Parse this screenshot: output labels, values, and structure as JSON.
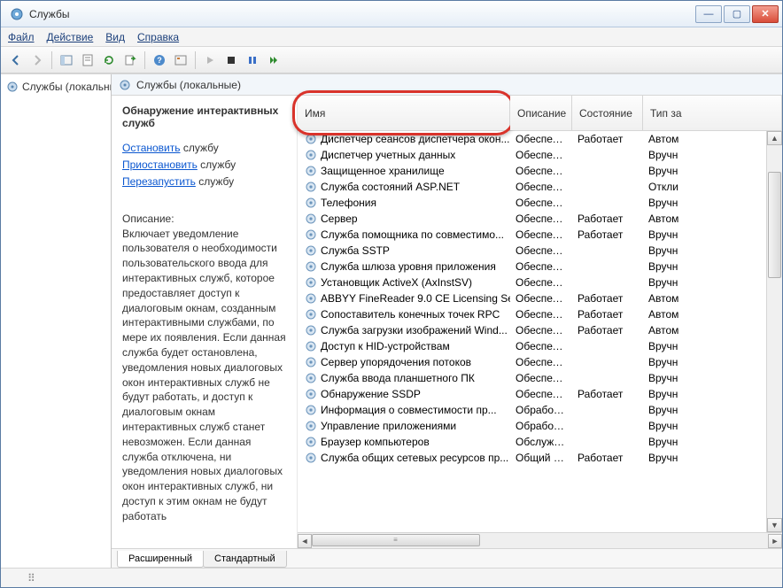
{
  "window": {
    "title": "Службы"
  },
  "menu": {
    "file": "Файл",
    "action": "Действие",
    "view": "Вид",
    "help": "Справка"
  },
  "toolbar_icons": [
    "back",
    "forward",
    "sep",
    "show-hide",
    "props",
    "export",
    "refresh",
    "export-list",
    "sep",
    "help",
    "filter",
    "sep",
    "play",
    "stop",
    "pause",
    "restart"
  ],
  "tree": {
    "root": "Службы (локальны"
  },
  "main_header": "Службы (локальные)",
  "detail": {
    "service_name": "Обнаружение интерактивных служб",
    "actions": {
      "stop_link": "Остановить",
      "stop_suffix": " службу",
      "pause_link": "Приостановить",
      "pause_suffix": " службу",
      "restart_link": "Перезапустить",
      "restart_suffix": " службу"
    },
    "desc_label": "Описание:",
    "desc_text": "Включает уведомление пользователя о необходимости пользовательского ввода для интерактивных служб, которое предоставляет доступ к диалоговым окнам, созданным интерактивными службами, по мере их появления. Если данная служба будет остановлена, уведомления новых диалоговых окон интерактивных служб не будут работать, и доступ к диалоговым окнам интерактивных служб станет невозможен. Если данная служба отключена, ни уведомления новых диалоговых окон интерактивных служб, ни доступ к этим окнам не будут работать"
  },
  "columns": {
    "name": "Имя",
    "desc": "Описание",
    "state": "Состояние",
    "type": "Тип за"
  },
  "services": [
    {
      "name": "Диспетчер сеансов диспетчера окон...",
      "desc": "Обеспечи...",
      "state": "Работает",
      "type": "Автом"
    },
    {
      "name": "Диспетчер учетных данных",
      "desc": "Обеспечи...",
      "state": "",
      "type": "Вручн"
    },
    {
      "name": "Защищенное хранилище",
      "desc": "Обеспечи...",
      "state": "",
      "type": "Вручн"
    },
    {
      "name": "Служба состояний ASP.NET",
      "desc": "Обеспечи...",
      "state": "",
      "type": "Откли"
    },
    {
      "name": "Телефония",
      "desc": "Обеспечи...",
      "state": "",
      "type": "Вручн"
    },
    {
      "name": "Сервер",
      "desc": "Обеспечи...",
      "state": "Работает",
      "type": "Автом"
    },
    {
      "name": "Служба помощника по совместимо...",
      "desc": "Обеспечи...",
      "state": "Работает",
      "type": "Вручн"
    },
    {
      "name": "Служба SSTP",
      "desc": "Обеспечи...",
      "state": "",
      "type": "Вручн"
    },
    {
      "name": "Служба шлюза уровня приложения",
      "desc": "Обеспечи...",
      "state": "",
      "type": "Вручн"
    },
    {
      "name": "Установщик ActiveX (AxInstSV)",
      "desc": "Обеспечи...",
      "state": "",
      "type": "Вручн"
    },
    {
      "name": "ABBYY FineReader 9.0 CE Licensing Se...",
      "desc": "Обеспечи...",
      "state": "Работает",
      "type": "Автом"
    },
    {
      "name": "Сопоставитель конечных точек RPC",
      "desc": "Обеспечи...",
      "state": "Работает",
      "type": "Автом"
    },
    {
      "name": "Служба загрузки изображений Wind...",
      "desc": "Обеспечи...",
      "state": "Работает",
      "type": "Автом"
    },
    {
      "name": "Доступ к HID-устройствам",
      "desc": "Обеспечи...",
      "state": "",
      "type": "Вручн"
    },
    {
      "name": "Сервер упорядочения потоков",
      "desc": "Обеспечи...",
      "state": "",
      "type": "Вручн"
    },
    {
      "name": "Служба ввода планшетного ПК",
      "desc": "Обеспечи...",
      "state": "",
      "type": "Вручн"
    },
    {
      "name": "Обнаружение SSDP",
      "desc": "Обеспечи...",
      "state": "Работает",
      "type": "Вручн"
    },
    {
      "name": "Информация о совместимости пр...",
      "desc": "Обработк...",
      "state": "",
      "type": "Вручн"
    },
    {
      "name": "Управление приложениями",
      "desc": "Обработк...",
      "state": "",
      "type": "Вручн"
    },
    {
      "name": "Браузер компьютеров",
      "desc": "Обслужи...",
      "state": "",
      "type": "Вручн"
    },
    {
      "name": "Служба общих сетевых ресурсов пр...",
      "desc": "Общий до...",
      "state": "Работает",
      "type": "Вручн"
    }
  ],
  "tabs": {
    "extended": "Расширенный",
    "standard": "Стандартный"
  }
}
